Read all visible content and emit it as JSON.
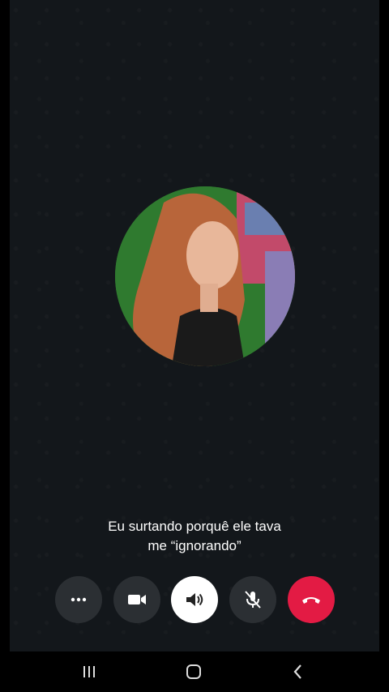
{
  "caption": {
    "line1": "Eu surtando porquê ele tava",
    "line2": "me “ignorando”"
  },
  "controls": [
    {
      "name": "more-options",
      "icon": "ellipsis-icon"
    },
    {
      "name": "video",
      "icon": "video-camera-icon"
    },
    {
      "name": "speaker",
      "icon": "speaker-icon",
      "active": true
    },
    {
      "name": "mute",
      "icon": "microphone-muted-icon"
    },
    {
      "name": "end-call",
      "icon": "phone-hangup-icon"
    }
  ],
  "colors": {
    "end_call": "#e31b44",
    "background": "#13171b",
    "control_bg": "#2b2f33"
  },
  "navbar": [
    "recent-apps-icon",
    "home-icon",
    "back-icon"
  ]
}
